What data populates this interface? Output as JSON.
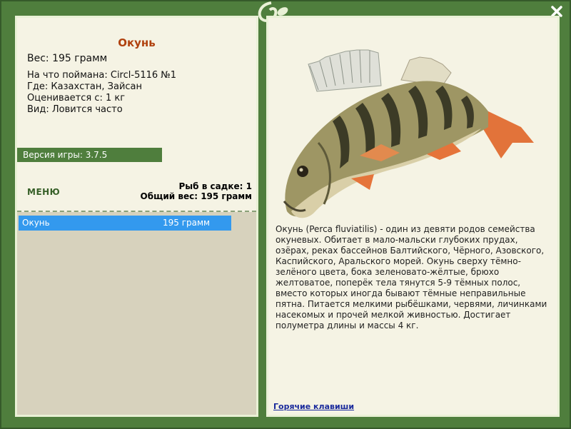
{
  "fish": {
    "name": "Окунь",
    "weight": "Вес: 195 грамм",
    "caught_on": "На что поймана: Circl-5116 №1",
    "location": "Где: Казахстан, Зайсан",
    "valued_from": "Оценивается с: 1 кг",
    "kind": "Вид: Ловится часто"
  },
  "version": "Версия игры: 3.7.5",
  "menu_label": "МЕНЮ",
  "keep": {
    "count": "Рыб в садке: 1",
    "total_weight": "Общий вес: 195 грамм"
  },
  "catch_list": [
    {
      "name": "Окунь",
      "weight": "195 грамм"
    }
  ],
  "description": "Окунь (Perca fluviatilis) - один из девяти родов семейства окуневых. Обитает в мало-мальски глубоких прудах, озёрах, реках бассейнов Балтийского, Чёрного, Азовского, Каспийского, Аральского морей. Окунь сверху тёмно-зелёного цвета, бока зеленовато-жёлтые, брюхо желтоватое, поперёк тела тянутся 5-9 тёмных полос, вместо которых иногда бывают тёмные неправильные пятна. Питается мелкими рыбёшками, червями, личинками насекомых и прочей мелкой живностью. Достигает полуметра длины и массы 4 кг.",
  "hotkeys_label": "Горячие клавиши",
  "icons": {
    "close": "close-icon",
    "ornament": "leaf-ornament-icon",
    "fish": "perch-image"
  },
  "colors": {
    "frame": "#4f7e3d",
    "panel": "#f5f3e4",
    "title": "#b0410e",
    "selection": "#3399ee"
  }
}
